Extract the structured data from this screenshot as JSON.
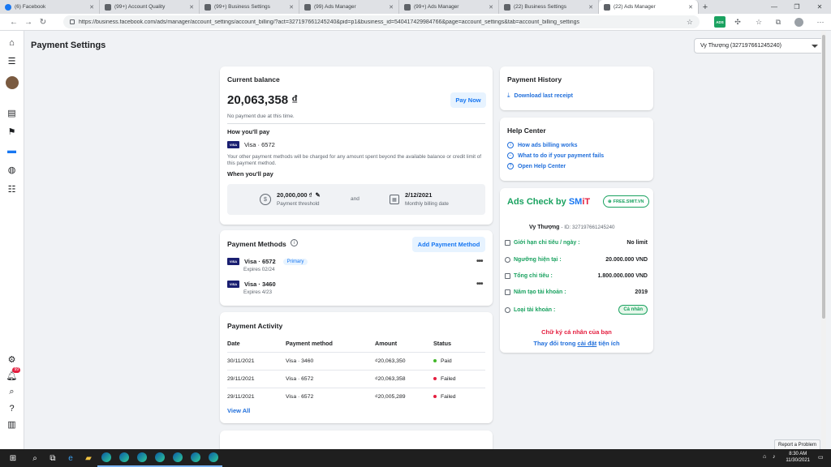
{
  "browser": {
    "tabs": [
      {
        "label": "(6) Facebook",
        "icon": "facebook-icon"
      },
      {
        "label": "(99+) Account Quality",
        "icon": "page-icon"
      },
      {
        "label": "(99+) Business Settings",
        "icon": "page-icon"
      },
      {
        "label": "(99) Ads Manager",
        "icon": "page-icon"
      },
      {
        "label": "(99+) Ads Manager",
        "icon": "page-icon"
      },
      {
        "label": "(22) Business Settings",
        "icon": "page-icon"
      },
      {
        "label": "(22) Ads Manager",
        "icon": "page-icon",
        "active": true
      }
    ],
    "url": "https://business.facebook.com/ads/manager/account_settings/account_billing/?act=327197661245240&pid=p1&business_id=540417429984766&page=account_settings&tab=account_billing_settings",
    "ads_ext_label": "ADS"
  },
  "header": {
    "title": "Payment Settings",
    "account_selector": "Vy Thượng (327197661245240)"
  },
  "leftnav": {
    "notification_count": "99"
  },
  "balance": {
    "title": "Current balance",
    "amount": "20,063,358 ₫",
    "pay_now": "Pay Now",
    "due_text": "No payment due at this time.",
    "how_pay": "How you'll pay",
    "card_label": "Visa · 6572",
    "visa_text": "VISA",
    "other_methods_note": "Your other payment methods will be charged for any amount spent beyond the available balance or credit limit of this payment method.",
    "when_pay": "When you'll pay",
    "threshold_value": "20,000,000 ₫",
    "threshold_label": "Payment threshold",
    "and_text": "and",
    "billing_date": "2/12/2021",
    "billing_label": "Monthly billing date"
  },
  "methods": {
    "title": "Payment Methods",
    "add_button": "Add Payment Method",
    "items": [
      {
        "label": "Visa · 6572",
        "expires": "Expires 02/24",
        "primary": "Primary"
      },
      {
        "label": "Visa · 3460",
        "expires": "Expires 4/23"
      }
    ]
  },
  "activity": {
    "title": "Payment Activity",
    "columns": [
      "Date",
      "Payment method",
      "Amount",
      "Status"
    ],
    "rows": [
      {
        "date": "30/11/2021",
        "method": "Visa · 3460",
        "amount": "₫20,063,350",
        "status": "Paid",
        "status_color": "#42b72a"
      },
      {
        "date": "29/11/2021",
        "method": "Visa · 6572",
        "amount": "₫20,063,358",
        "status": "Failed",
        "status_color": "#e41e3f"
      },
      {
        "date": "29/11/2021",
        "method": "Visa · 6572",
        "amount": "₫20,005,289",
        "status": "Failed",
        "status_color": "#e41e3f"
      }
    ],
    "view_all": "View All"
  },
  "history": {
    "title": "Payment History",
    "download": "Download last receipt"
  },
  "help": {
    "title": "Help Center",
    "links": [
      "How ads billing works",
      "What to do if your payment fails",
      "Open Help Center"
    ]
  },
  "ads_check": {
    "title_a": "Ads Check by ",
    "title_b": "SM",
    "title_c": "iT",
    "free_pill": "FREE.SMIT.VN",
    "user_name": "Vy Thượng",
    "user_id": "- ID: 327197661245240",
    "rows": [
      {
        "key": "Giới hạn chi tiêu / ngày :",
        "value": "No limit"
      },
      {
        "key": "Ngưỡng hiện tại :",
        "value": "20.000.000 VND"
      },
      {
        "key": "Tổng chi tiêu :",
        "value": "1.800.000.000 VND"
      },
      {
        "key": "Năm tạo tài khoản :",
        "value": "2019"
      },
      {
        "key": "Loại tài khoản :",
        "value": "Cá nhân"
      }
    ],
    "signature": "Chữ ký cá nhân của bạn",
    "change_prefix": "Thay đổi trong ",
    "change_link": "cài đặt",
    "change_suffix": " tiện ích"
  },
  "taskbar": {
    "time": "8:30 AM",
    "date": "11/30/2021",
    "report": "Report a Problem"
  },
  "colors": {
    "accent": "#1877f2",
    "success": "#42b72a",
    "danger": "#e41e3f",
    "ads_green": "#1aa260"
  }
}
